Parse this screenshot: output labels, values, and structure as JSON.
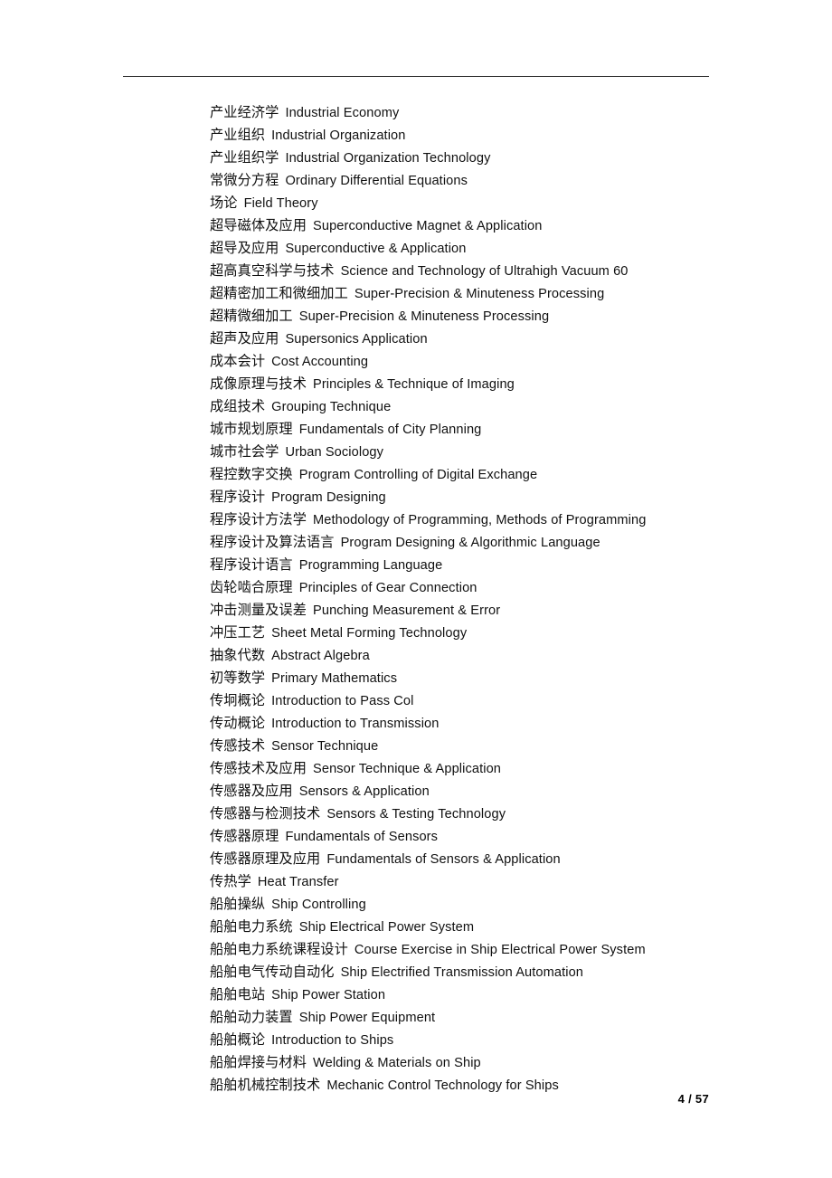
{
  "document": {
    "page_label": "4 / 57",
    "header_rule": true,
    "entries": [
      {
        "zh": "产业经济学",
        "en": "Industrial Economy"
      },
      {
        "zh": "产业组织",
        "en": "Industrial Organization"
      },
      {
        "zh": "产业组织学",
        "en": "Industrial Organization Technology"
      },
      {
        "zh": "常微分方程",
        "en": "Ordinary Differential Equations"
      },
      {
        "zh": "场论",
        "en": "Field Theory"
      },
      {
        "zh": "超导磁体及应用",
        "en": "Superconductive Magnet & Application"
      },
      {
        "zh": "超导及应用",
        "en": "Superconductive & Application"
      },
      {
        "zh": "超高真空科学与技术",
        "en": "Science and Technology of Ultrahigh Vacuum 60"
      },
      {
        "zh": "超精密加工和微细加工",
        "en": "Super-Precision & Minuteness Processing"
      },
      {
        "zh": "超精微细加工",
        "en": "Super-Precision & Minuteness Processing"
      },
      {
        "zh": "超声及应用",
        "en": "Supersonics Application"
      },
      {
        "zh": "成本会计",
        "en": "Cost Accounting"
      },
      {
        "zh": "成像原理与技术",
        "en": "Principles & Technique of Imaging"
      },
      {
        "zh": "成组技术",
        "en": "Grouping Technique"
      },
      {
        "zh": "城市规划原理",
        "en": "Fundamentals of City Planning"
      },
      {
        "zh": "城市社会学",
        "en": "Urban Sociology"
      },
      {
        "zh": "程控数字交换",
        "en": "Program Controlling of Digital Exchange"
      },
      {
        "zh": "程序设计",
        "en": "Program Designing"
      },
      {
        "zh": "程序设计方法学",
        "en": "Methodology of Programming, Methods of Programming"
      },
      {
        "zh": "程序设计及算法语言",
        "en": "Program Designing & Algorithmic Language"
      },
      {
        "zh": "程序设计语言",
        "en": "Programming Language"
      },
      {
        "zh": "齿轮啮合原理",
        "en": "Principles of Gear Connection"
      },
      {
        "zh": "冲击测量及误差",
        "en": "Punching Measurement & Error"
      },
      {
        "zh": "冲压工艺",
        "en": "Sheet Metal Forming Technology"
      },
      {
        "zh": "抽象代数",
        "en": "Abstract Algebra"
      },
      {
        "zh": "初等数学",
        "en": "Primary Mathematics"
      },
      {
        "zh": "传坰概论",
        "en": "Introduction to Pass Col"
      },
      {
        "zh": "传动概论",
        "en": "Introduction to Transmission"
      },
      {
        "zh": "传感技术",
        "en": "Sensor Technique"
      },
      {
        "zh": "传感技术及应用",
        "en": "Sensor Technique & Application"
      },
      {
        "zh": "传感器及应用",
        "en": "Sensors & Application"
      },
      {
        "zh": "传感器与检测技术",
        "en": "Sensors & Testing Technology"
      },
      {
        "zh": "传感器原理",
        "en": "Fundamentals of Sensors"
      },
      {
        "zh": "传感器原理及应用",
        "en": "Fundamentals of Sensors & Application"
      },
      {
        "zh": "传热学",
        "en": "Heat Transfer"
      },
      {
        "zh": "船舶操纵",
        "en": "Ship Controlling"
      },
      {
        "zh": "船舶电力系统",
        "en": "Ship Electrical Power System"
      },
      {
        "zh": "船舶电力系统课程设计",
        "en": "Course Exercise in Ship Electrical Power System"
      },
      {
        "zh": "船舶电气传动自动化",
        "en": "Ship Electrified Transmission Automation"
      },
      {
        "zh": "船舶电站",
        "en": "Ship Power Station"
      },
      {
        "zh": "船舶动力装置",
        "en": "Ship Power Equipment"
      },
      {
        "zh": "船舶概论",
        "en": "Introduction to Ships"
      },
      {
        "zh": "船舶焊接与材料",
        "en": "Welding & Materials on Ship"
      },
      {
        "zh": "船舶机械控制技术",
        "en": "Mechanic Control Technology for Ships"
      }
    ]
  }
}
